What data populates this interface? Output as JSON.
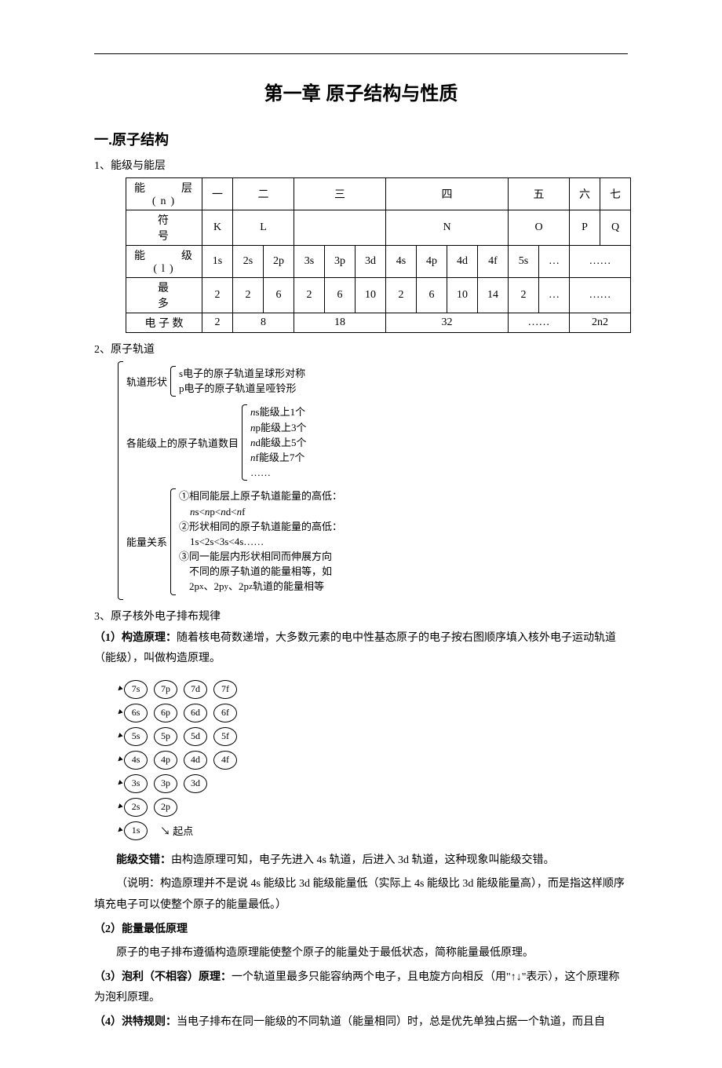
{
  "title": "第一章  原子结构与性质",
  "section1": {
    "heading": "一.原子结构",
    "item1_label": "1、能级与能层",
    "table": {
      "r1c1": "能　　层(n)",
      "r1c2": "一",
      "r1c3": "二",
      "r1c4": "三",
      "r1c5": "四",
      "r1c6": "五",
      "r1c7": "六",
      "r1c8": "七",
      "r2c1": "符　　　号",
      "r2c2": "K",
      "r2c3": "L",
      "r2c4": "",
      "r2c5": "N",
      "r2c6": "O",
      "r2c7": "P",
      "r2c8": "Q",
      "r3c1": "能　　级(l)",
      "r3c2": "1s",
      "r3c3": "2s",
      "r3c4": "2p",
      "r3c5": "3s",
      "r3c6": "3p",
      "r3c7": "3d",
      "r3c8": "4s",
      "r3c9": "4p",
      "r3c10": "4d",
      "r3c11": "4f",
      "r3c12": "5s",
      "r3c13": "…",
      "r3c14": "……",
      "r4c1": "最　　　多",
      "r4c2": "2",
      "r4c3": "2",
      "r4c4": "6",
      "r4c5": "2",
      "r4c6": "6",
      "r4c7": "10",
      "r4c8": "2",
      "r4c9": "6",
      "r4c10": "10",
      "r4c11": "14",
      "r4c12": "2",
      "r4c13": "…",
      "r4c14": "……",
      "r5c1": "电 子 数",
      "r5c2": "2",
      "r5c3": "8",
      "r5c4": "18",
      "r5c5": "32",
      "r5c6": "……",
      "r5c7": "2n2"
    },
    "item2_label": "2、原子轨道",
    "bracket": {
      "shape_label": "轨道形状",
      "shape1": "s电子的原子轨道呈球形对称",
      "shape2": "p电子的原子轨道呈哑铃形",
      "count_label": "各能级上的原子轨道数目",
      "c1": "ns能级上1个",
      "c2": "np能级上3个",
      "c3": "nd能级上5个",
      "c4": "nf能级上7个",
      "c5": "……",
      "energy_label": "能量关系",
      "e1": "①相同能层上原子轨道能量的高低：",
      "e1b": "ns<np<nd<nf",
      "e2": "②形状相同的原子轨道能量的高低：",
      "e2b": "1s<2s<3s<4s……",
      "e3": "③同一能层内形状相同而伸展方向",
      "e3b": "　不同的原子轨道的能量相等，如",
      "e3c": "　2pₓ、2pᵧ、2p_z轨道的能量相等"
    },
    "item3_label": "3、原子核外电子排布规律",
    "rule1_head": "（1）构造原理：",
    "rule1_body": "随着核电荷数递增，大多数元素的电中性基态原子的电子按右图顺序填入核外电子运动轨道（能级），叫做构造原理。",
    "aufbau": {
      "rows": [
        [
          "7s",
          "7p",
          "7d",
          "7f"
        ],
        [
          "6s",
          "6p",
          "6d",
          "6f"
        ],
        [
          "5s",
          "5p",
          "5d",
          "5f"
        ],
        [
          "4s",
          "4p",
          "4d",
          "4f"
        ],
        [
          "3s",
          "3p",
          "3d"
        ],
        [
          "2s",
          "2p"
        ],
        [
          "1s"
        ]
      ],
      "start": "起点"
    },
    "cross_head": "能级交错：",
    "cross_body": "由构造原理可知，电子先进入 4s 轨道，后进入 3d 轨道，这种现象叫能级交错。",
    "cross_note": "（说明：构造原理并不是说 4s 能级比 3d 能级能量低（实际上 4s 能级比 3d 能级能量高），而是指这样顺序填充电子可以使整个原子的能量最低。）",
    "rule2_head": "（2）能量最低原理",
    "rule2_body": "原子的电子排布遵循构造原理能使整个原子的能量处于最低状态，简称能量最低原理。",
    "rule3_head": "（3）泡利（不相容）原理：",
    "rule3_body": "一个轨道里最多只能容纳两个电子，且电旋方向相反（用\"↑↓\"表示），这个原理称为泡利原理。",
    "rule4_head": "（4）洪特规则：",
    "rule4_body": "当电子排布在同一能级的不同轨道（能量相同）时，总是优先单独占据一个轨道，而且自"
  }
}
